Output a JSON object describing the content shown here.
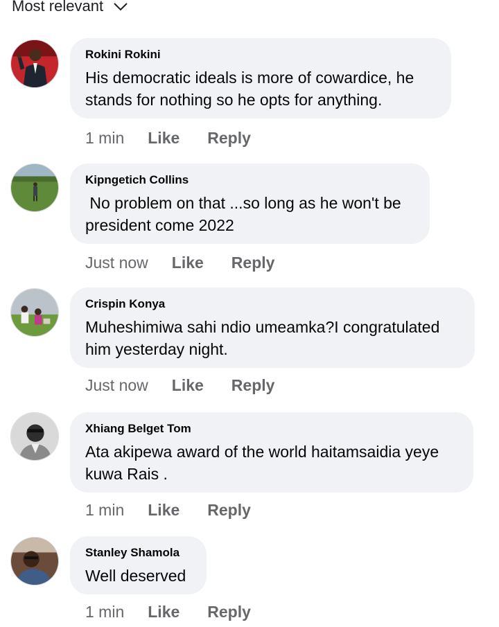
{
  "sort": {
    "label": "Most relevant",
    "icon": "chevron-down-icon"
  },
  "comments": [
    {
      "author": "Rokini Rokini",
      "text": "His democratic ideals is more of cowardice, he stands for nothing so he opts for anything.",
      "time": "1 min",
      "like": "Like",
      "reply": "Reply"
    },
    {
      "author": "Kipngetich Collins",
      "text": " No problem on that ...so long as he won't be president come 2022",
      "time": "Just now",
      "like": "Like",
      "reply": "Reply"
    },
    {
      "author": "Crispin Konya",
      "text": "Muheshimiwa sahi ndio umeamka?I congratulated him yesterday night.",
      "time": "Just now",
      "like": "Like",
      "reply": "Reply"
    },
    {
      "author": "Xhiang Belget Tom",
      "text": "Ata akipewa award of the world haitamsaidia yeye kuwa Rais .",
      "time": "1 min",
      "like": "Like",
      "reply": "Reply"
    },
    {
      "author": "Stanley Shamola",
      "text": "Well deserved",
      "time": "1 min",
      "like": "Like",
      "reply": "Reply"
    }
  ],
  "colors": {
    "bubble": "#f0f2f5",
    "meta_text": "#65676b",
    "body_text": "#050505"
  }
}
